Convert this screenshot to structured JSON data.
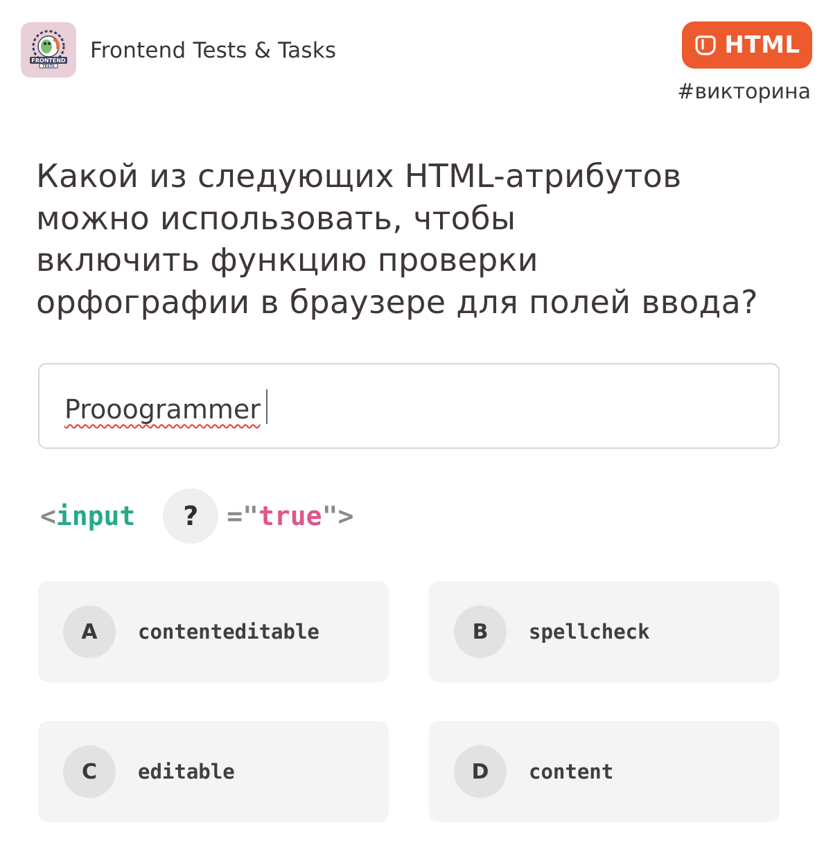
{
  "header": {
    "channel_name": "Frontend Tests & Tasks",
    "logo_text_top": "FRONTEND",
    "logo_text_bottom": "TESTS",
    "badge_label": "HTML",
    "badge_color": "#ed5a2e",
    "hashtag": "#викторина"
  },
  "question": {
    "lines": [
      "Какой из следующих HTML-атрибутов",
      "можно использовать, чтобы",
      "включить функцию проверки",
      "орфографии в браузере для полей ввода?"
    ]
  },
  "demo_input": {
    "value": "Prooogrammer"
  },
  "code": {
    "open": "<",
    "tag": "input",
    "placeholder": "?",
    "equals": "=\"",
    "value": "true",
    "close": "\">"
  },
  "options": [
    {
      "letter": "A",
      "text": "contenteditable"
    },
    {
      "letter": "B",
      "text": "spellcheck"
    },
    {
      "letter": "C",
      "text": "editable"
    },
    {
      "letter": "D",
      "text": "content"
    }
  ]
}
